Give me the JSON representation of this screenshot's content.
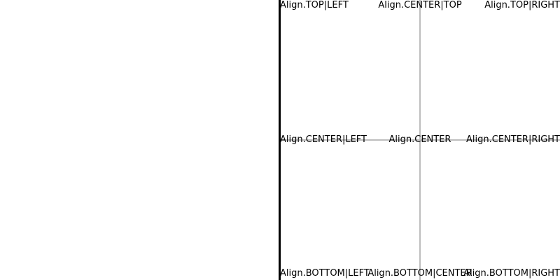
{
  "labels": {
    "top_left": "Align.TOP|LEFT",
    "top_center": "Align.CENTER|TOP",
    "top_right": "Align.TOP|RIGHT",
    "center_left": "Align.CENTER|LEFT",
    "center": "Align.CENTER",
    "center_right": "Align.CENTER|RIGHT",
    "bottom_left": "Align.BOTTOM|LEFT",
    "bottom_center": "Align.BOTTOM|CENTER",
    "bottom_right": "Align.BOTTOM|RIGHT"
  },
  "colors": {
    "background": "#ffffff",
    "divider": "#000000",
    "guide_lines": "#bdbdbd",
    "text": "#000000"
  }
}
